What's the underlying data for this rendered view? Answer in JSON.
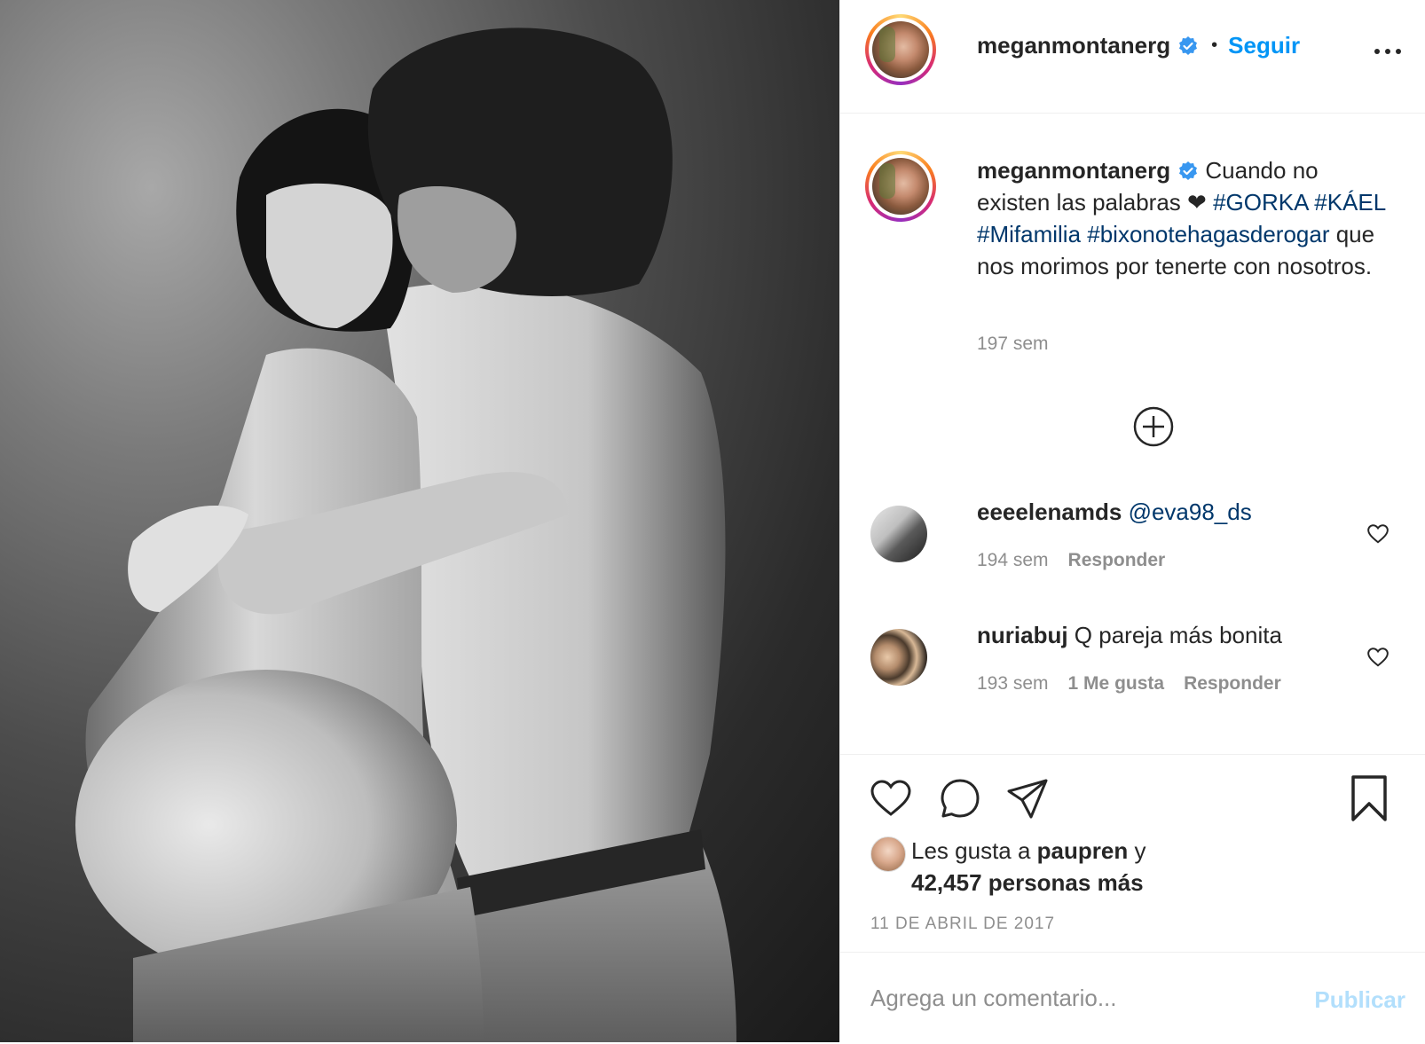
{
  "colors": {
    "accent": "#0095f6",
    "hashtag": "#00376b",
    "muted": "#8e8e8e",
    "publish_disabled": "#b2dffc",
    "text": "#262626",
    "verified": "#3897f0"
  },
  "header": {
    "username": "meganmontanerg",
    "separator": "•",
    "follow_label": "Seguir",
    "more_icon": "more-horizontal-icon"
  },
  "caption": {
    "username": "meganmontanerg",
    "text_before": "Cuando no existen las palabras",
    "heart_emoji": "❤",
    "tag1": "#GORKA",
    "tag2": "#KÁEL",
    "tag3": "#Mifamilia",
    "tag4": "#bixonotehagasderogar",
    "text_after": "que nos morimos por tenerte con nosotros.",
    "time": "197 sem"
  },
  "load_more_icon": "plus-circle-icon",
  "comments": [
    {
      "username": "eeeelenamds",
      "text": "@eva98_ds",
      "time": "194 sem",
      "likes": "",
      "reply": "Responder"
    },
    {
      "username": "nuriabuj",
      "text": "Q pareja más bonita",
      "time": "193 sem",
      "likes": "1 Me gusta",
      "reply": "Responder"
    }
  ],
  "likes": {
    "prefix": "Les gusta a",
    "user": "paupren",
    "conjunction": "y",
    "count_text": "42,457 personas más"
  },
  "date": "11 DE ABRIL DE 2017",
  "add_comment": {
    "placeholder": "Agrega un comentario...",
    "publish_label": "Publicar"
  }
}
